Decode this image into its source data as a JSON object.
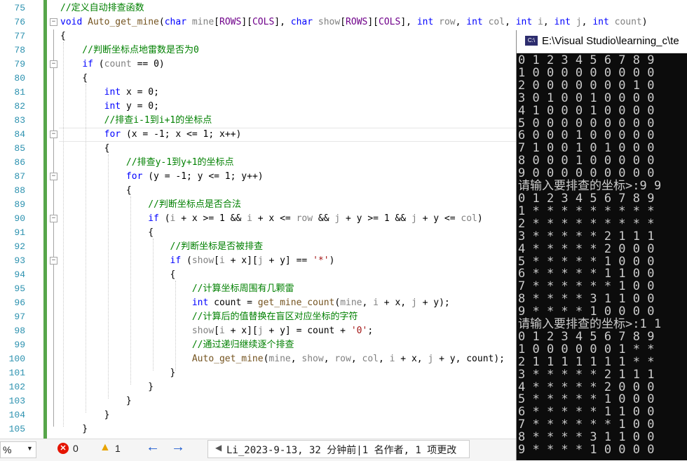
{
  "editor": {
    "lines": [
      {
        "n": "75",
        "segs": [
          {
            "t": "//定义自动排查函数",
            "c": "cm"
          }
        ]
      },
      {
        "n": "76",
        "segs": [
          {
            "t": "void ",
            "c": "kw"
          },
          {
            "t": "Auto_get_mine",
            "c": "fn"
          },
          {
            "t": "("
          },
          {
            "t": "char ",
            "c": "kw"
          },
          {
            "t": "mine",
            "c": "pm"
          },
          {
            "t": "["
          },
          {
            "t": "ROWS",
            "c": "mc"
          },
          {
            "t": "]["
          },
          {
            "t": "COLS",
            "c": "mc"
          },
          {
            "t": "], "
          },
          {
            "t": "char ",
            "c": "kw"
          },
          {
            "t": "show",
            "c": "pm"
          },
          {
            "t": "["
          },
          {
            "t": "ROWS",
            "c": "mc"
          },
          {
            "t": "]["
          },
          {
            "t": "COLS",
            "c": "mc"
          },
          {
            "t": "], "
          },
          {
            "t": "int ",
            "c": "kw"
          },
          {
            "t": "row",
            "c": "pm"
          },
          {
            "t": ", "
          },
          {
            "t": "int ",
            "c": "kw"
          },
          {
            "t": "col",
            "c": "pm"
          },
          {
            "t": ", "
          },
          {
            "t": "int ",
            "c": "kw"
          },
          {
            "t": "i",
            "c": "pm"
          },
          {
            "t": ", "
          },
          {
            "t": "int ",
            "c": "kw"
          },
          {
            "t": "j",
            "c": "pm"
          },
          {
            "t": ", "
          },
          {
            "t": "int ",
            "c": "kw"
          },
          {
            "t": "count",
            "c": "pm"
          },
          {
            "t": ")"
          }
        ]
      },
      {
        "n": "77",
        "segs": [
          {
            "t": "{"
          }
        ]
      },
      {
        "n": "78",
        "segs": [
          {
            "t": "    //判断坐标点地雷数是否为0",
            "c": "cm"
          }
        ]
      },
      {
        "n": "79",
        "segs": [
          {
            "t": "    "
          },
          {
            "t": "if ",
            "c": "kw"
          },
          {
            "t": "("
          },
          {
            "t": "count",
            "c": "pm"
          },
          {
            "t": " == 0)"
          }
        ]
      },
      {
        "n": "80",
        "segs": [
          {
            "t": "    {"
          }
        ]
      },
      {
        "n": "81",
        "segs": [
          {
            "t": "        "
          },
          {
            "t": "int ",
            "c": "kw"
          },
          {
            "t": "x = 0;"
          }
        ]
      },
      {
        "n": "82",
        "segs": [
          {
            "t": "        "
          },
          {
            "t": "int ",
            "c": "kw"
          },
          {
            "t": "y = 0;"
          }
        ]
      },
      {
        "n": "83",
        "segs": [
          {
            "t": "        //排查i-1到i+1的坐标点",
            "c": "cm"
          }
        ]
      },
      {
        "n": "84",
        "segs": [
          {
            "t": "        "
          },
          {
            "t": "for ",
            "c": "kw"
          },
          {
            "t": "(x = -1; x <= 1; x++)"
          }
        ]
      },
      {
        "n": "85",
        "segs": [
          {
            "t": "        {"
          }
        ]
      },
      {
        "n": "86",
        "segs": [
          {
            "t": "            //排查y-1到y+1的坐标点",
            "c": "cm"
          }
        ]
      },
      {
        "n": "87",
        "segs": [
          {
            "t": "            "
          },
          {
            "t": "for ",
            "c": "kw"
          },
          {
            "t": "(y = -1; y <= 1; y++)"
          }
        ]
      },
      {
        "n": "88",
        "segs": [
          {
            "t": "            {"
          }
        ]
      },
      {
        "n": "89",
        "segs": [
          {
            "t": "                //判断坐标点是否合法",
            "c": "cm"
          }
        ]
      },
      {
        "n": "90",
        "segs": [
          {
            "t": "                "
          },
          {
            "t": "if ",
            "c": "kw"
          },
          {
            "t": "("
          },
          {
            "t": "i",
            "c": "pm"
          },
          {
            "t": " + x >= 1 && "
          },
          {
            "t": "i",
            "c": "pm"
          },
          {
            "t": " + x <= "
          },
          {
            "t": "row",
            "c": "pm"
          },
          {
            "t": " && "
          },
          {
            "t": "j",
            "c": "pm"
          },
          {
            "t": " + y >= 1 && "
          },
          {
            "t": "j",
            "c": "pm"
          },
          {
            "t": " + y <= "
          },
          {
            "t": "col",
            "c": "pm"
          },
          {
            "t": ")"
          }
        ]
      },
      {
        "n": "91",
        "segs": [
          {
            "t": "                {"
          }
        ]
      },
      {
        "n": "92",
        "segs": [
          {
            "t": "                    //判断坐标是否被排查",
            "c": "cm"
          }
        ]
      },
      {
        "n": "93",
        "segs": [
          {
            "t": "                    "
          },
          {
            "t": "if ",
            "c": "kw"
          },
          {
            "t": "("
          },
          {
            "t": "show",
            "c": "pm"
          },
          {
            "t": "["
          },
          {
            "t": "i",
            "c": "pm"
          },
          {
            "t": " + x]["
          },
          {
            "t": "j",
            "c": "pm"
          },
          {
            "t": " + y] == "
          },
          {
            "t": "'*'",
            "c": "st"
          },
          {
            "t": ")"
          }
        ]
      },
      {
        "n": "94",
        "segs": [
          {
            "t": "                    {"
          }
        ]
      },
      {
        "n": "95",
        "segs": [
          {
            "t": "                        //计算坐标周围有几颗雷",
            "c": "cm"
          }
        ]
      },
      {
        "n": "96",
        "segs": [
          {
            "t": "                        "
          },
          {
            "t": "int ",
            "c": "kw"
          },
          {
            "t": "count = "
          },
          {
            "t": "get_mine_count",
            "c": "fn"
          },
          {
            "t": "("
          },
          {
            "t": "mine",
            "c": "pm"
          },
          {
            "t": ", "
          },
          {
            "t": "i",
            "c": "pm"
          },
          {
            "t": " + x, "
          },
          {
            "t": "j",
            "c": "pm"
          },
          {
            "t": " + y);"
          }
        ]
      },
      {
        "n": "97",
        "segs": [
          {
            "t": "                        //计算后的值替换在盲区对应坐标的字符",
            "c": "cm"
          }
        ]
      },
      {
        "n": "98",
        "segs": [
          {
            "t": "                        "
          },
          {
            "t": "show",
            "c": "pm"
          },
          {
            "t": "["
          },
          {
            "t": "i",
            "c": "pm"
          },
          {
            "t": " + x]["
          },
          {
            "t": "j",
            "c": "pm"
          },
          {
            "t": " + y] = count + "
          },
          {
            "t": "'0'",
            "c": "st"
          },
          {
            "t": ";"
          }
        ]
      },
      {
        "n": "99",
        "segs": [
          {
            "t": "                        //通过递归继续逐个排查",
            "c": "cm"
          }
        ]
      },
      {
        "n": "100",
        "segs": [
          {
            "t": "                        "
          },
          {
            "t": "Auto_get_mine",
            "c": "fn"
          },
          {
            "t": "("
          },
          {
            "t": "mine",
            "c": "pm"
          },
          {
            "t": ", "
          },
          {
            "t": "show",
            "c": "pm"
          },
          {
            "t": ", "
          },
          {
            "t": "row",
            "c": "pm"
          },
          {
            "t": ", "
          },
          {
            "t": "col",
            "c": "pm"
          },
          {
            "t": ", "
          },
          {
            "t": "i",
            "c": "pm"
          },
          {
            "t": " + x, "
          },
          {
            "t": "j",
            "c": "pm"
          },
          {
            "t": " + y, count);"
          }
        ]
      },
      {
        "n": "101",
        "segs": [
          {
            "t": "                    }"
          }
        ]
      },
      {
        "n": "102",
        "segs": [
          {
            "t": "                }"
          }
        ]
      },
      {
        "n": "103",
        "segs": [
          {
            "t": "            }"
          }
        ]
      },
      {
        "n": "104",
        "segs": [
          {
            "t": "        }"
          }
        ]
      },
      {
        "n": "105",
        "segs": [
          {
            "t": "    }"
          }
        ]
      }
    ]
  },
  "statusbar": {
    "zoom": "%",
    "errors": "0",
    "warnings": "1",
    "git_info": "Li_2023-9-13, 32 分钟前|1 名作者, 1 项更改"
  },
  "console": {
    "title": "E:\\Visual Studio\\learning_c\\te",
    "icon_label": "C:\\",
    "lines": [
      "0 1 2 3 4 5 6 7 8 9",
      "1 0 0 0 0 0 0 0 0 0",
      "2 0 0 0 0 0 0 0 1 0",
      "3 0 1 0 0 1 0 0 0 0",
      "4 1 0 0 0 1 0 0 0 0",
      "5 0 0 0 0 0 0 0 0 0",
      "6 0 0 0 1 0 0 0 0 0",
      "7 1 0 0 1 0 1 0 0 0",
      "8 0 0 0 1 0 0 0 0 0",
      "9 0 0 0 0 0 0 0 0 0",
      "请输入要排查的坐标>:9 9",
      "0 1 2 3 4 5 6 7 8 9",
      "1 * * * * * * * * *",
      "2 * * * * * * * * *",
      "3 * * * * * 2 1 1 1",
      "4 * * * * * 2 0 0 0",
      "5 * * * * * 1 0 0 0",
      "6 * * * * * 1 1 0 0",
      "7 * * * * * * 1 0 0",
      "8 * * * * 3 1 1 0 0",
      "9 * * * * 1 0 0 0 0",
      "请输入要排查的坐标>:1 1",
      "0 1 2 3 4 5 6 7 8 9",
      "1 0 0 0 0 0 0 1 * *",
      "2 1 1 1 1 1 1 1 * *",
      "3 * * * * * 2 1 1 1",
      "4 * * * * * 2 0 0 0",
      "5 * * * * * 1 0 0 0",
      "6 * * * * * 1 1 0 0",
      "7 * * * * * * 1 0 0",
      "8 * * * * 3 1 1 0 0",
      "9 * * * * 1 0 0 0 0"
    ]
  }
}
